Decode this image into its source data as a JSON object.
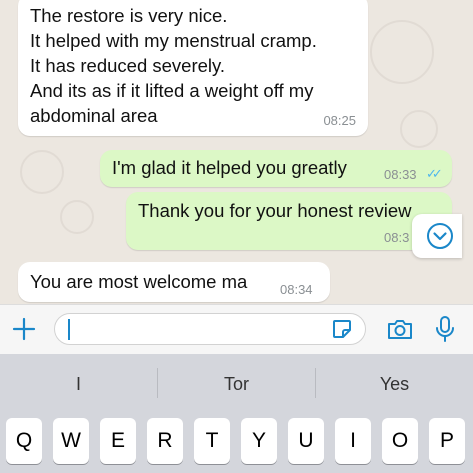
{
  "messages": [
    {
      "direction": "incoming",
      "lines": [
        "The restore is very nice.",
        "It helped with my menstrual cramp.",
        "It has reduced severely.",
        "And its as if it lifted a weight off my",
        "abdominal area"
      ],
      "time": "08:25"
    },
    {
      "direction": "outgoing",
      "text": "I'm glad it helped you greatly",
      "time": "08:33",
      "status": "read"
    },
    {
      "direction": "outgoing",
      "text": "Thank you for your honest review",
      "time": "08:3",
      "status": "read"
    },
    {
      "direction": "incoming",
      "text": "You are most welcome ma",
      "time": "08:34"
    }
  ],
  "composer": {
    "plus_icon": "plus-icon",
    "sticker_icon": "sticker-icon",
    "camera_icon": "camera-icon",
    "mic_icon": "microphone-icon",
    "input_value": ""
  },
  "keyboard": {
    "suggestions": [
      "I",
      "Tor",
      "Yes"
    ],
    "row1": [
      "Q",
      "W",
      "E",
      "R",
      "T",
      "Y",
      "U",
      "I",
      "O",
      "P"
    ]
  },
  "colors": {
    "outgoing_bubble": "#dcf8c6",
    "incoming_bubble": "#ffffff",
    "accent": "#1a87c9",
    "read_tick": "#4fb6ec"
  }
}
